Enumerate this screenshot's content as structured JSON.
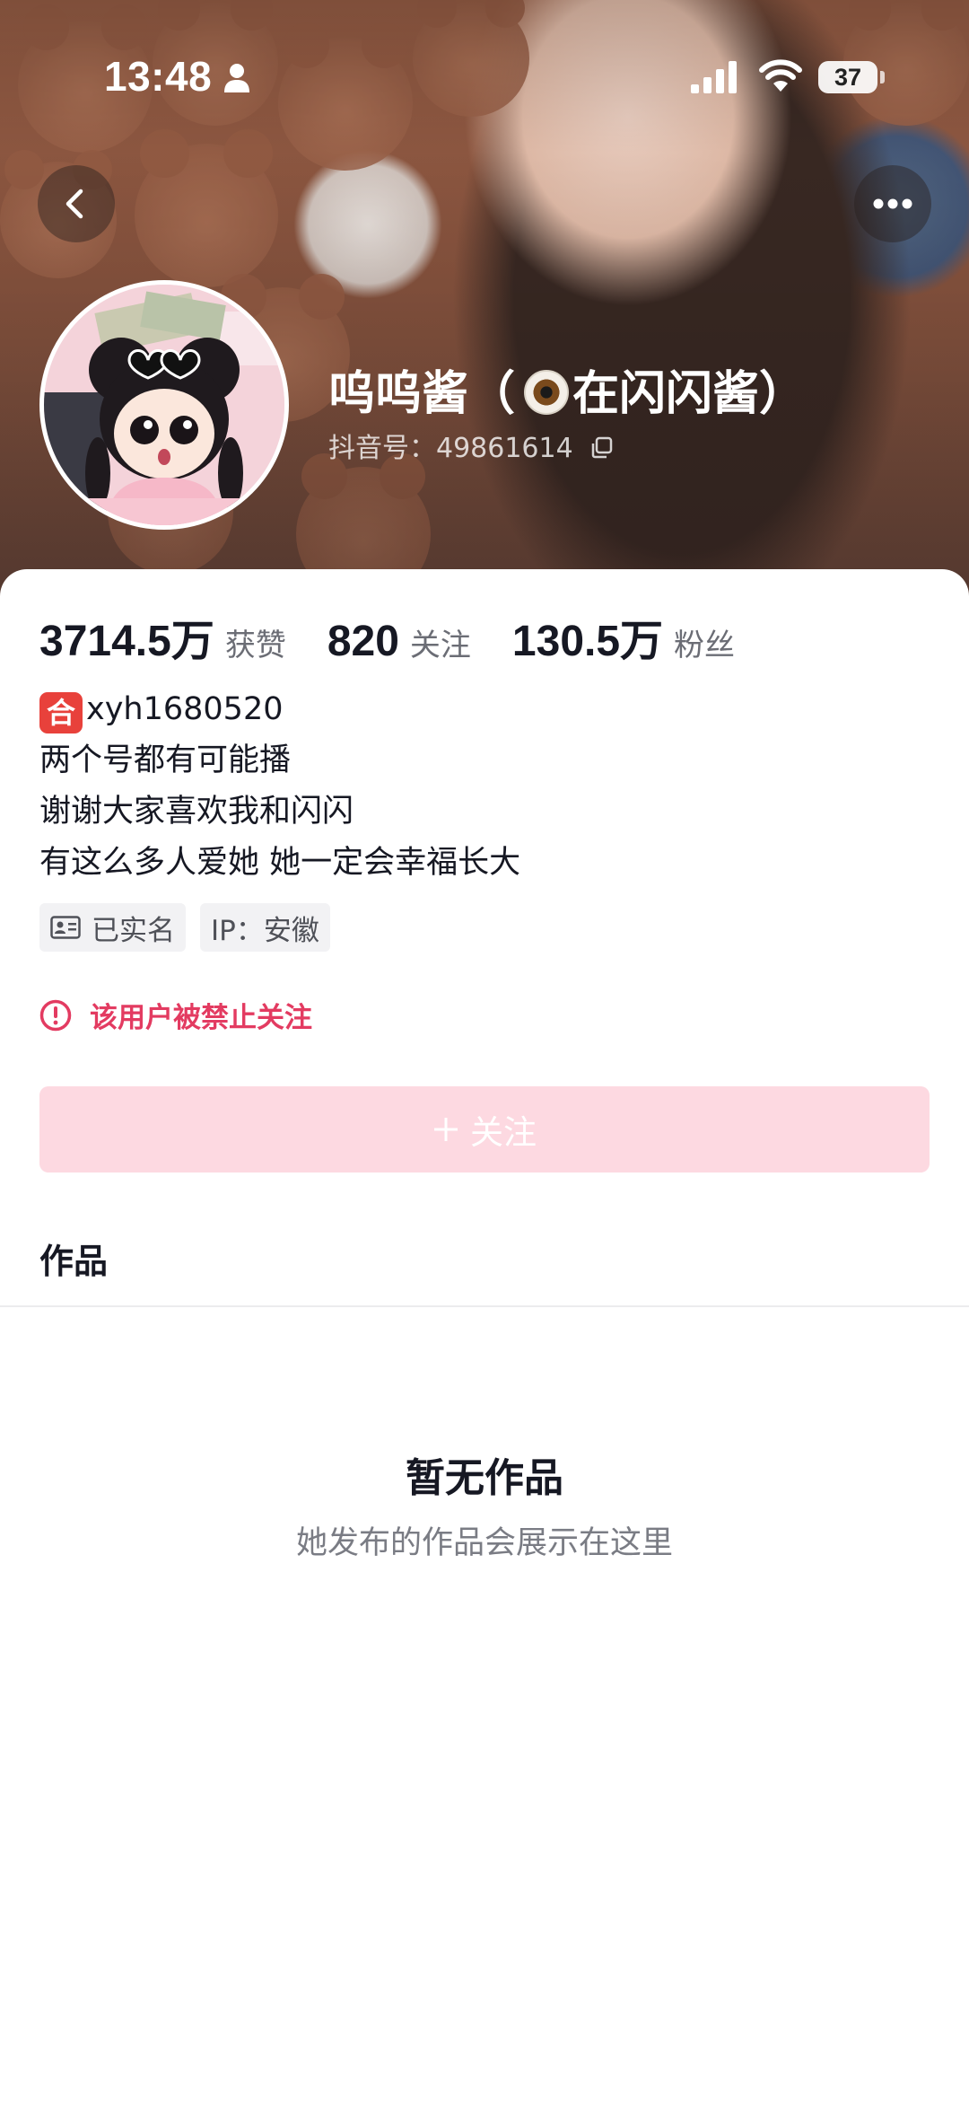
{
  "status_bar": {
    "time": "13:48",
    "battery": "37"
  },
  "profile": {
    "nickname_prefix": "呜呜酱（",
    "nickname_suffix": "在闪闪酱）",
    "douyin_id": "抖音号：49861614"
  },
  "stats": [
    {
      "value": "3714.5万",
      "label": "获赞"
    },
    {
      "value": "820",
      "label": "关注"
    },
    {
      "value": "130.5万",
      "label": "粉丝"
    }
  ],
  "bio": {
    "badge": "合",
    "line1": "xyh1680520",
    "line2": "两个号都有可能播",
    "line3": "谢谢大家喜欢我和闪闪",
    "line4": "有这么多人爱她 她一定会幸福长大"
  },
  "tags": {
    "verified": "已实名",
    "ip": "IP：安徽"
  },
  "notice": "该用户被禁止关注",
  "follow_button": "关注",
  "works_tab": "作品",
  "empty_state": {
    "title": "暂无作品",
    "subtitle": "她发布的作品会展示在这里"
  },
  "colors": {
    "accent": "#e33b61",
    "follow_disabled_bg": "#fdd9e1",
    "tag_bg": "#f2f2f4"
  },
  "icons": [
    "person-icon",
    "signal-icon",
    "wifi-icon",
    "back-icon",
    "more-icon",
    "copy-icon",
    "id-card-icon",
    "warning-icon",
    "plus-icon"
  ]
}
